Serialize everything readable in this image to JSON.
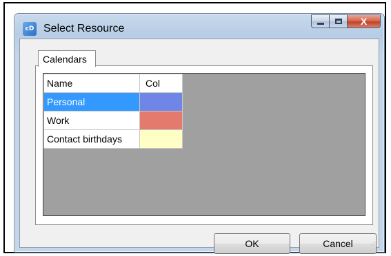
{
  "window": {
    "title": "Select Resource",
    "app_icon_text": "cD",
    "controls": {
      "minimize": "minimize",
      "maximize": "maximize",
      "close": "X"
    }
  },
  "tabs": [
    {
      "label": "Calendars",
      "selected": true
    }
  ],
  "table": {
    "columns": [
      "Name",
      "Col"
    ],
    "rows": [
      {
        "name": "Personal",
        "color": "#6f86e6",
        "selected": true
      },
      {
        "name": "Work",
        "color": "#e47a6e",
        "selected": false
      },
      {
        "name": "Contact birthdays",
        "color": "#fffec4",
        "selected": false
      }
    ]
  },
  "buttons": {
    "ok": "OK",
    "cancel": "Cancel"
  },
  "colors": {
    "selection": "#3399ff",
    "grid_background": "#a0a0a0"
  }
}
